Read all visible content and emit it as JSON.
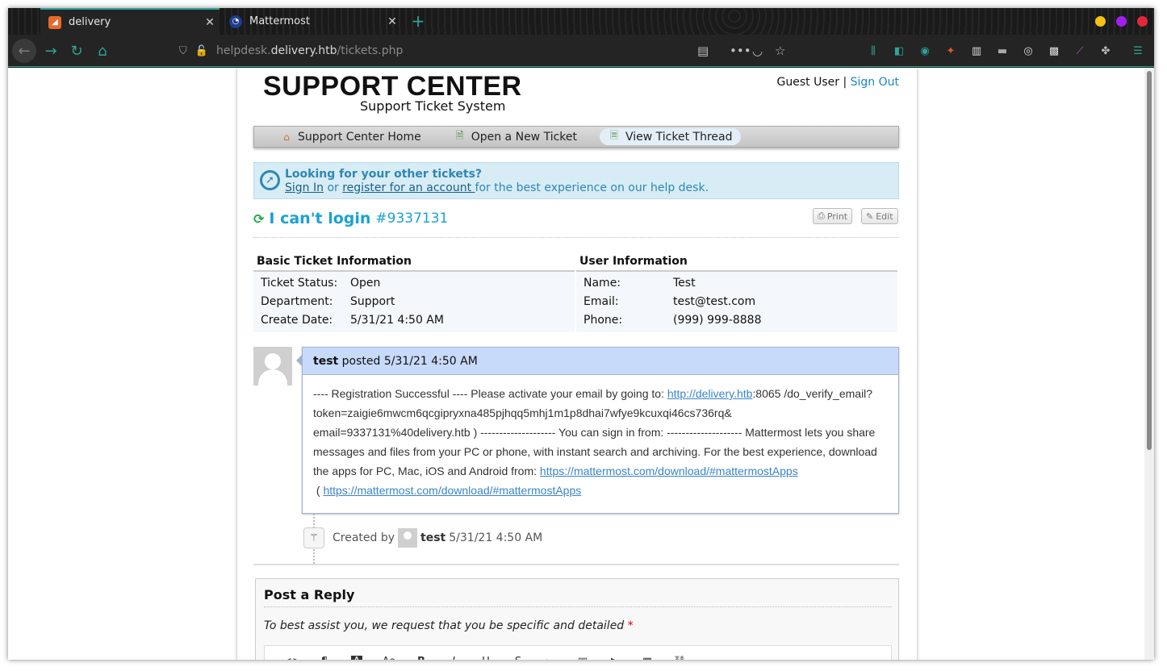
{
  "browser": {
    "tabs": [
      {
        "title": "delivery",
        "active": true
      },
      {
        "title": "Mattermost",
        "active": false
      }
    ],
    "url": {
      "prefix": "helpdesk.",
      "domain": "delivery.htb",
      "path": "/tickets.php"
    }
  },
  "site": {
    "title": "SUPPORT CENTER",
    "subtitle": "Support Ticket System",
    "guest_label": "Guest User",
    "separator": "|",
    "signout_label": "Sign Out"
  },
  "nav": [
    {
      "label": "Support Center Home",
      "icon": "home-icon"
    },
    {
      "label": "Open a New Ticket",
      "icon": "new-ticket-icon"
    },
    {
      "label": "View Ticket Thread",
      "icon": "ticket-thread-icon"
    }
  ],
  "notice": {
    "title": "Looking for your other tickets?",
    "signin_label": "Sign In",
    "or_text": " or ",
    "register_label": "register for an account ",
    "rest_text": "for the best experience on our help desk."
  },
  "ticket": {
    "subject": "I can't login",
    "number": "#9337131",
    "print_label": "Print",
    "edit_label": "Edit"
  },
  "basic_info": {
    "heading": "Basic Ticket Information",
    "rows": [
      {
        "key": "Ticket Status:",
        "value": "Open"
      },
      {
        "key": "Department:",
        "value": "Support"
      },
      {
        "key": "Create Date:",
        "value": "5/31/21 4:50 AM"
      }
    ]
  },
  "user_info": {
    "heading": "User Information",
    "rows": [
      {
        "key": "Name:",
        "value": "Test"
      },
      {
        "key": "Email:",
        "value": "test@test.com"
      },
      {
        "key": "Phone:",
        "value": "(999) 999-8888"
      }
    ]
  },
  "thread": {
    "author": "test",
    "posted_text": " posted 5/31/21 4:50 AM",
    "body_start": "---- Registration Successful ---- Please activate your email by going to: ",
    "link1": "http://delivery.htb",
    "body_mid": ":8065 /do_verify_email?token=zaigie6mwcm6qcgipryxna485pjhqq5mhj1m1p8dhai7wfye9kcuxqi46cs736rq& email=9337131%40delivery.htb ) -------------------- You can sign in from: -------------------- Mattermost lets you share messages and files from your PC or phone, with instant search and archiving. For the best experience, download the apps for PC, Mac, iOS and Android from: ",
    "link2": "https://mattermost.com/download/#mattermostApps",
    "body_paren": " ( ",
    "link3": "https://mattermost.com/download/#mattermostApps"
  },
  "event": {
    "created_by": "Created by",
    "author": "test",
    "time": "5/31/21 4:50 AM"
  },
  "reply": {
    "title": "Post a Reply",
    "note": "To best assist you, we request that you be specific and detailed",
    "required_mark": "*",
    "toolbar": [
      "<>",
      "¶",
      "A",
      "Aa",
      "B",
      "I",
      "U",
      "S",
      "≔",
      "▣",
      "▶",
      "▦",
      "⛓",
      "—"
    ]
  },
  "colors": {
    "accent": "#2fa39a",
    "link": "#1a86c4",
    "ticket_title": "#1aa2d4",
    "thread_header": "#c8dafa",
    "notice_bg": "#d7ecf5"
  }
}
